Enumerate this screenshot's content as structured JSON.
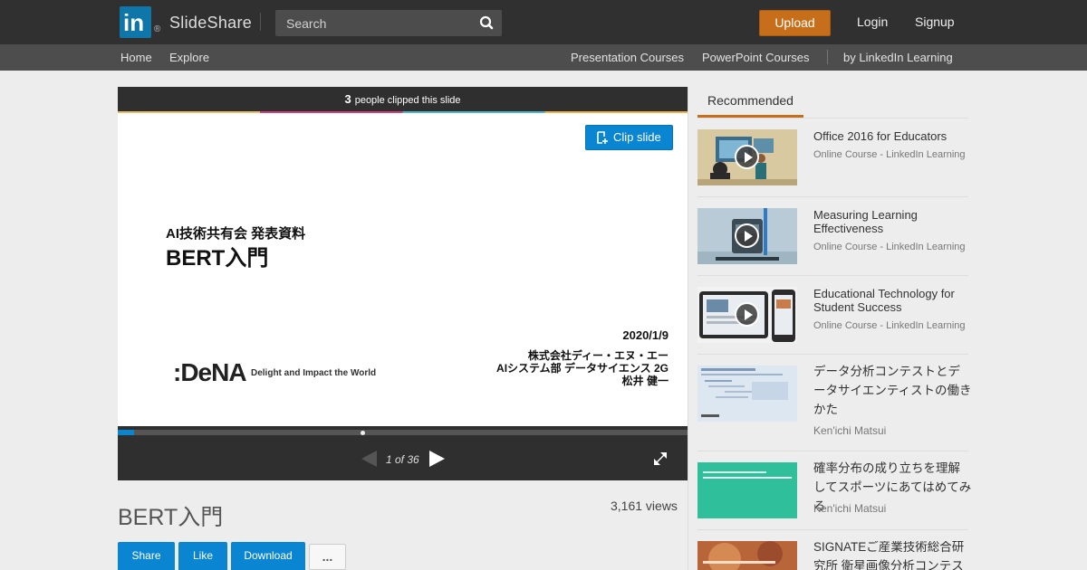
{
  "header": {
    "logo_mark": "in",
    "logo_reg": "®",
    "logo_text": "SlideShare",
    "search_placeholder": "Search",
    "upload_label": "Upload",
    "login_label": "Login",
    "signup_label": "Signup"
  },
  "nav": {
    "home": "Home",
    "explore": "Explore",
    "presentation_courses": "Presentation Courses",
    "powerpoint_courses": "PowerPoint Courses",
    "linkedin_learning": "by LinkedIn Learning"
  },
  "player": {
    "clip_count": "3",
    "clip_count_suffix": "people clipped this slide",
    "clip_button": "Clip slide",
    "page_indicator": "1 of 36",
    "progress_fraction": 0.028,
    "slide": {
      "subtitle": "AI技術共有会 発表資料",
      "title": "BERT入門",
      "date": "2020/1/9",
      "org_line1": "株式会社ディー・エヌ・エー",
      "org_line2": "AIシステム部 データサイエンス 2G",
      "org_line3": "松井 健一",
      "logo": ":DeNA",
      "tagline": "Delight and Impact the World"
    }
  },
  "doc": {
    "title": "BERT入門",
    "views": "3,161 views",
    "share": "Share",
    "like": "Like",
    "download": "Download",
    "more": "..."
  },
  "sidebar": {
    "tab": "Recommended",
    "items": [
      {
        "title": "Office 2016 for Educators",
        "sub": "Online Course - LinkedIn Learning"
      },
      {
        "title": "Measuring Learning Effectiveness",
        "sub": "Online Course - LinkedIn Learning"
      },
      {
        "title": "Educational Technology for Student Success",
        "sub": "Online Course - LinkedIn Learning"
      },
      {
        "title": "データ分析コンテストとデータサイエンティストの働きかた",
        "sub": "Ken'ichi Matsui"
      },
      {
        "title": "確率分布の成り立ちを理解してスポーツにあてはめてみる",
        "sub": "Ken'ichi Matsui"
      },
      {
        "title": "SIGNATEご産業技術総合研究所 衛星画像分析コンテスト",
        "sub": ""
      }
    ]
  },
  "colors": {
    "topbar": "#303030",
    "navbar": "#4d4d4d",
    "accent_orange": "#c76e1a",
    "accent_blue": "#0a85d1"
  }
}
